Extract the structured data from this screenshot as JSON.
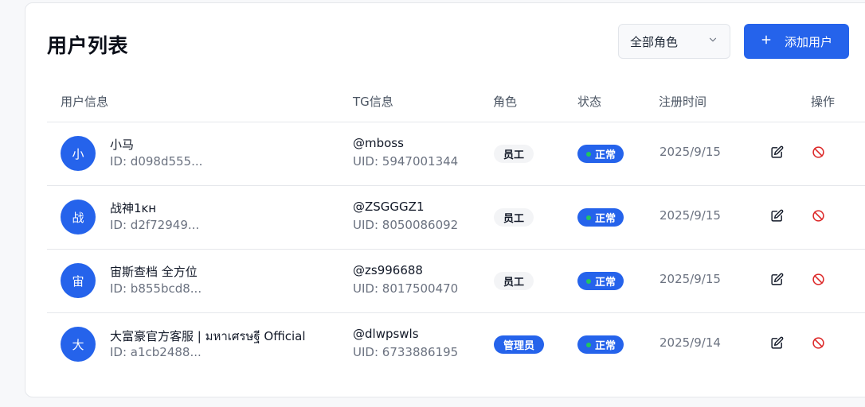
{
  "header": {
    "title": "用户列表",
    "role_filter": {
      "selected": "全部角色"
    },
    "add_button": {
      "label": "添加用户"
    }
  },
  "table": {
    "columns": [
      "用户信息",
      "TG信息",
      "角色",
      "状态",
      "注册时间",
      "操作"
    ],
    "rows": [
      {
        "avatar": "小",
        "name": "小马",
        "id": "ID: d098d555...",
        "tg": "@mboss",
        "tg_uid": "UID: 5947001344",
        "role": "员工",
        "role_type": "staff",
        "status": "正常",
        "date": "2025/9/15"
      },
      {
        "avatar": "战",
        "name": "战神1ĸн",
        "id": "ID: d2f72949...",
        "tg": "@ZSGGGZ1",
        "tg_uid": "UID: 8050086092",
        "role": "员工",
        "role_type": "staff",
        "status": "正常",
        "date": "2025/9/15"
      },
      {
        "avatar": "宙",
        "name": "宙斯查档 全方位",
        "id": "ID: b855bcd8...",
        "tg": "@zs996688",
        "tg_uid": "UID: 8017500470",
        "role": "员工",
        "role_type": "staff",
        "status": "正常",
        "date": "2025/9/15"
      },
      {
        "avatar": "大",
        "name": "大富豪官方客服 | มหาเศรษฐี Official",
        "id": "ID: a1cb2488...",
        "tg": "@dlwpswls",
        "tg_uid": "UID: 6733886195",
        "role": "管理员",
        "role_type": "admin",
        "status": "正常",
        "date": "2025/9/14"
      }
    ]
  },
  "colors": {
    "primary": "#2563eb",
    "status_dot": "#22c55e",
    "danger": "#dc2626"
  },
  "icons": {
    "add": "plus-icon",
    "filter": "chevron-down-icon",
    "edit": "edit-icon",
    "ban": "ban-icon"
  }
}
